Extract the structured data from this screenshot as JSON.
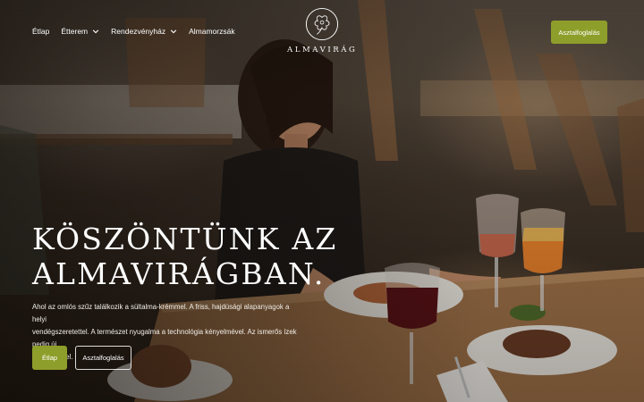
{
  "nav": {
    "items": [
      {
        "label": "Étlap",
        "dropdown": false
      },
      {
        "label": "Étterem",
        "dropdown": true
      },
      {
        "label": "Rendezvényház",
        "dropdown": true
      },
      {
        "label": "Almamorzsák",
        "dropdown": false
      }
    ]
  },
  "logo": {
    "text": "ALMAVIRÁG",
    "icon": "apple-blossom-icon"
  },
  "header": {
    "cta_label": "Asztalfoglalás"
  },
  "hero": {
    "headline_lines": [
      "KÖSZÖNTÜNK AZ",
      "ALMAVIRÁGBAN."
    ],
    "lead_lines": [
      "Ahol az omlós szűz találkozik a sültalma-krémmel. A friss, hajdúsági alapanyagok a helyi",
      "vendégszeretettel. A természet nyugalma a technológia kényelmével. Az ismerős ízek pedig új",
      "élményekkel."
    ],
    "primary_label": "Étlap",
    "secondary_label": "Asztalfoglalás"
  },
  "colors": {
    "accent": "#8e9e2a",
    "text": "#ffffff"
  }
}
